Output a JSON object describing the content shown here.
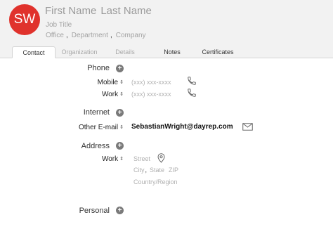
{
  "header": {
    "avatar_initials": "SW",
    "first_name": "First Name",
    "last_name": "Last Name",
    "job_title": "Job Title",
    "office": "Office",
    "department": "Department",
    "company": "Company",
    "separator": ","
  },
  "tabs": [
    {
      "label": "Contact",
      "active": true
    },
    {
      "label": "Organization",
      "active": false
    },
    {
      "label": "Details",
      "active": false
    },
    {
      "label": "Notes",
      "active": false
    },
    {
      "label": "Certificates",
      "active": false
    }
  ],
  "phone": {
    "section_label": "Phone",
    "rows": [
      {
        "label": "Mobile",
        "placeholder": "(xxx) xxx-xxxx"
      },
      {
        "label": "Work",
        "placeholder": "(xxx) xxx-xxxx"
      }
    ]
  },
  "internet": {
    "section_label": "Internet",
    "email_label": "Other E-mail",
    "email_value": "SebastianWright@dayrep.com"
  },
  "address": {
    "section_label": "Address",
    "row_label": "Work",
    "street_placeholder": "Street",
    "city_placeholder": "City",
    "state_placeholder": "State",
    "zip_placeholder": "ZIP",
    "country_placeholder": "Country/Region"
  },
  "personal": {
    "section_label": "Personal"
  },
  "icons": {
    "add": "plus-circle-icon",
    "phone": "phone-icon",
    "mail": "mail-icon",
    "location": "location-pin-icon",
    "dropdown": "chevron-updown-icon"
  },
  "colors": {
    "avatar_bg": "#e0322c",
    "header_bg": "#f2f2f2"
  }
}
